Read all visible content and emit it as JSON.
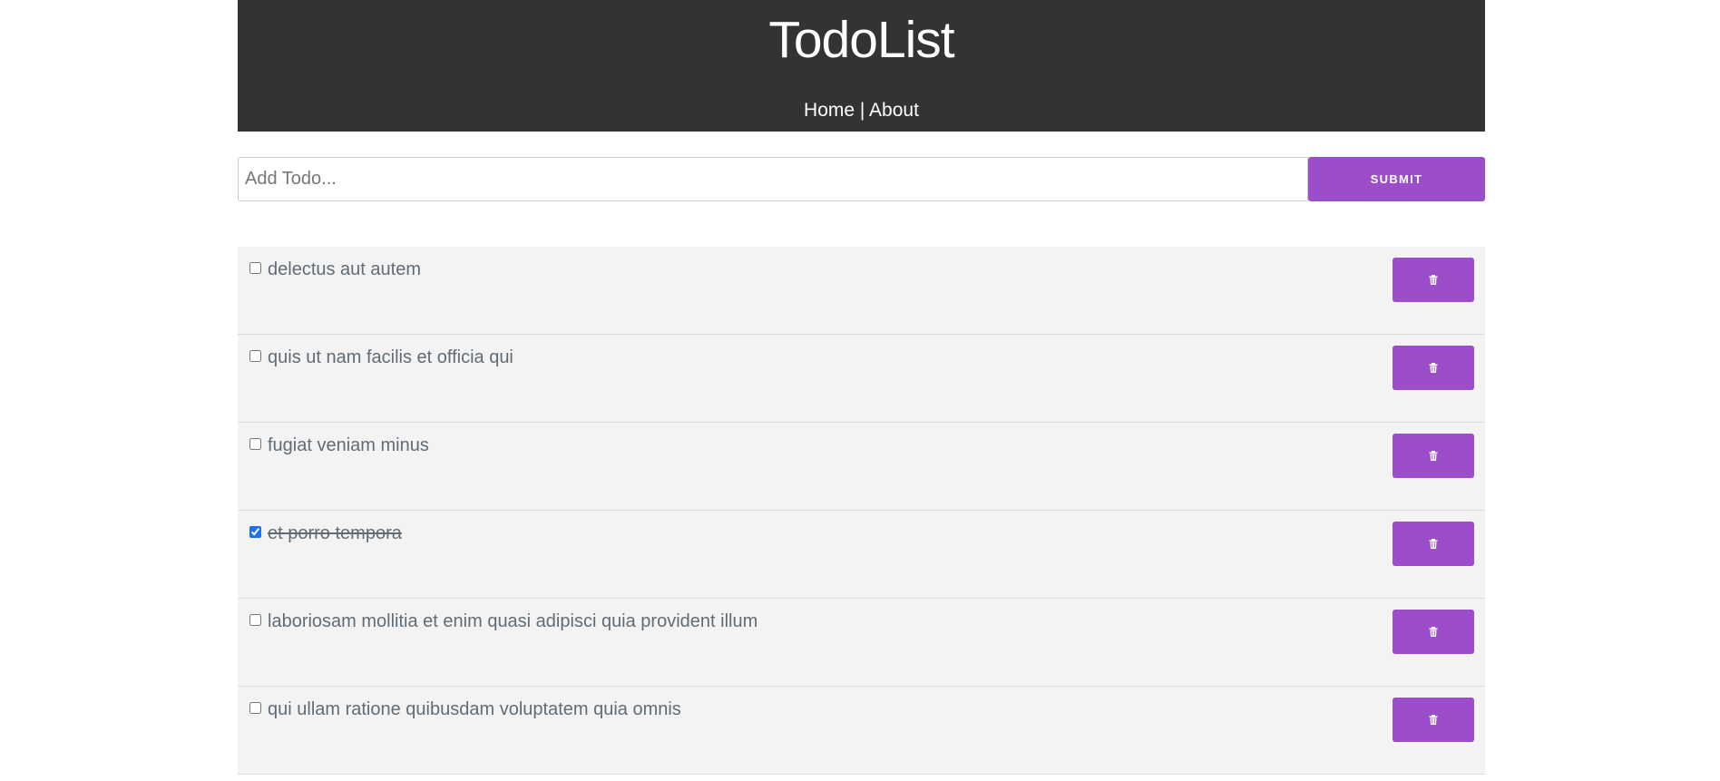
{
  "header": {
    "title": "TodoList",
    "nav": {
      "home_label": "Home",
      "separator": " | ",
      "about_label": "About"
    }
  },
  "add_form": {
    "placeholder": "Add Todo...",
    "value": "",
    "submit_label": "Submit"
  },
  "todos": [
    {
      "title": "delectus aut autem",
      "completed": false,
      "delete_icon": "trash-icon"
    },
    {
      "title": "quis ut nam facilis et officia qui",
      "completed": false,
      "delete_icon": "trash-icon"
    },
    {
      "title": "fugiat veniam minus",
      "completed": false,
      "delete_icon": "trash-icon"
    },
    {
      "title": "et porro tempora",
      "completed": true,
      "delete_icon": "trash-icon"
    },
    {
      "title": "laboriosam mollitia et enim quasi adipisci quia provident illum",
      "completed": false,
      "delete_icon": "trash-icon"
    },
    {
      "title": "qui ullam ratione quibusdam voluptatem quia omnis",
      "completed": false,
      "delete_icon": "trash-icon"
    }
  ],
  "colors": {
    "header_bg": "#333333",
    "accent": "#9b4dca",
    "item_bg": "#f3f3f3",
    "item_text": "#606c76"
  }
}
